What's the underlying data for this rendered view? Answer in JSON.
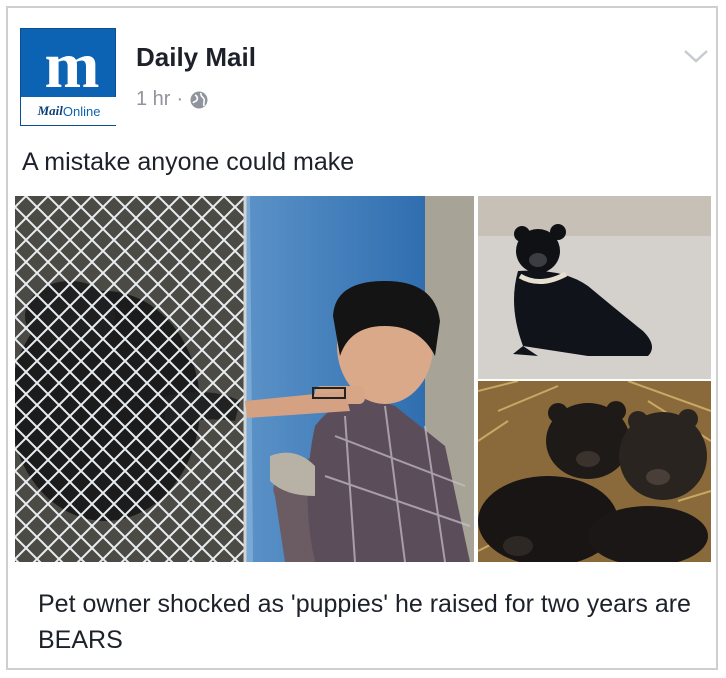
{
  "post": {
    "page_name": "Daily Mail",
    "logo_glyph": "m",
    "logo_mail": "Mail",
    "logo_online": "Online",
    "timestamp": "1 hr",
    "separator": "·",
    "audience_icon": "globe-icon",
    "menu_icon": "chevron-down-icon",
    "caption": "A mistake anyone could make",
    "link_headline": "Pet owner shocked as 'puppies' he raised for two years are BEARS"
  },
  "colors": {
    "brand_blue": "#0d63b3",
    "meta_gray": "#90949c",
    "text_dark": "#1d2129"
  }
}
